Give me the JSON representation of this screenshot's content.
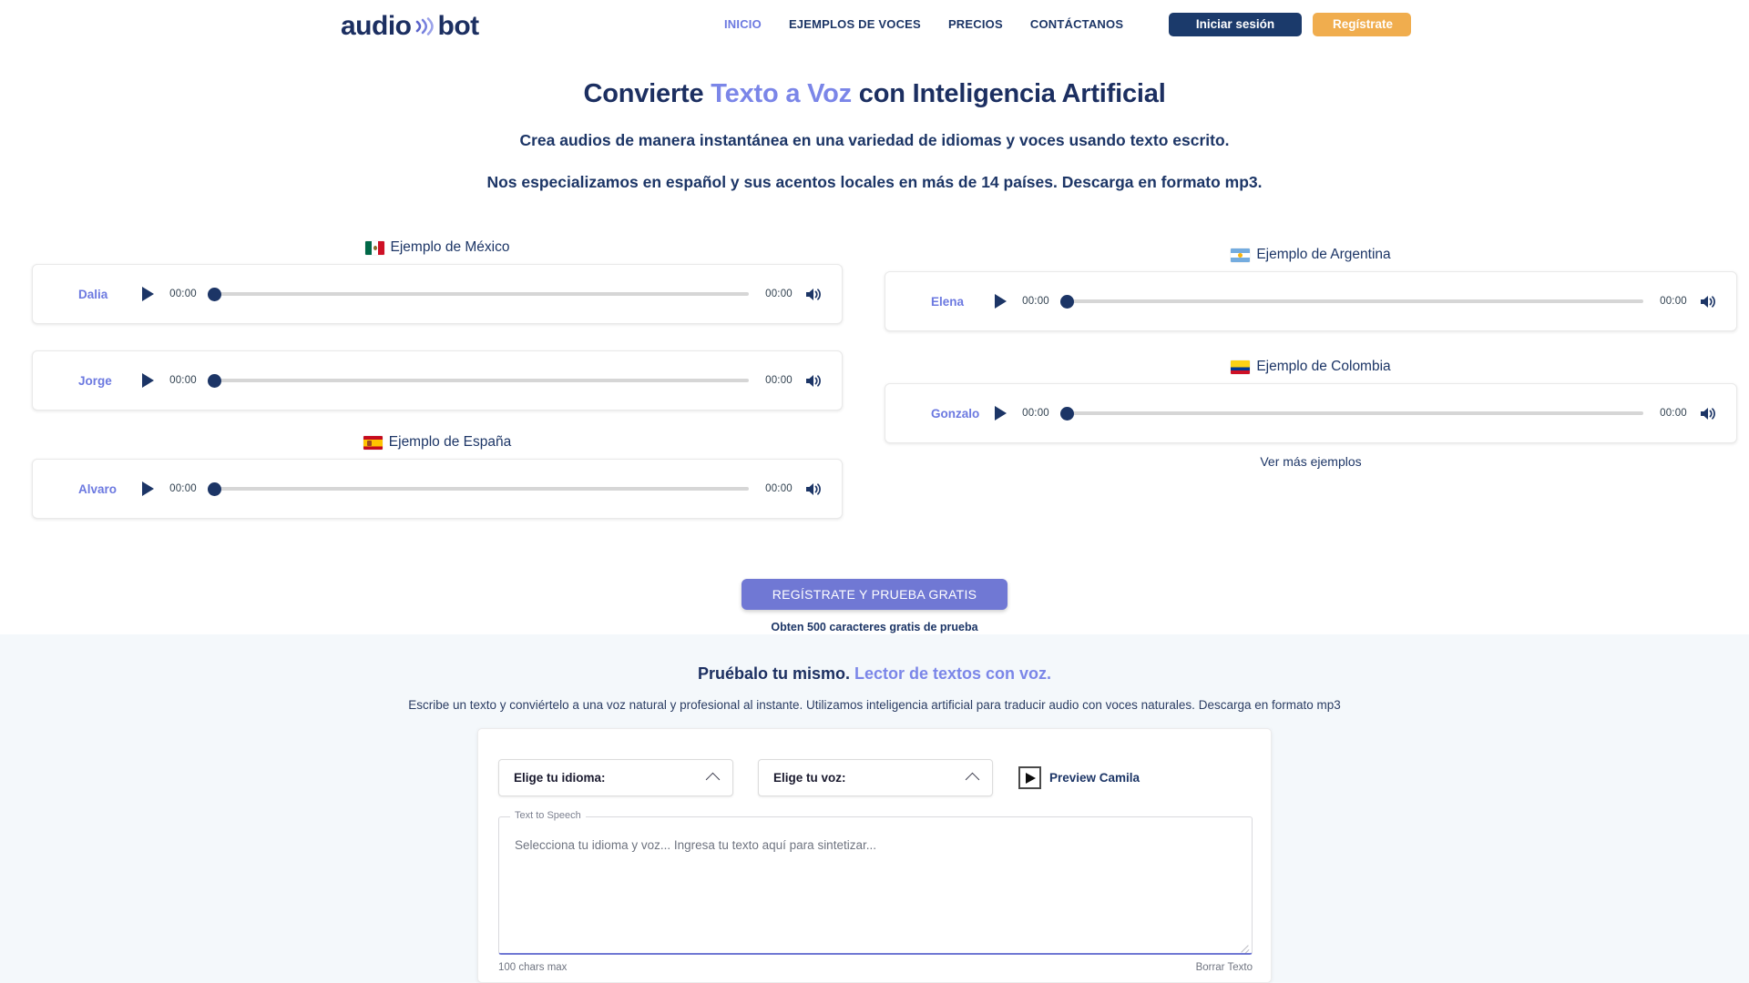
{
  "header": {
    "logo": {
      "part1": "audio",
      "part2": "bot",
      "icon": "sound-wave-icon"
    },
    "nav": [
      {
        "label": "INICIO",
        "active": true
      },
      {
        "label": "EJEMPLOS DE VOCES",
        "active": false
      },
      {
        "label": "PRECIOS",
        "active": false
      },
      {
        "label": "CONTÁCTANOS",
        "active": false
      }
    ],
    "login_label": "Iniciar sesión",
    "signup_label": "Regístrate",
    "colors": {
      "login_bg": "#1b3a6b",
      "signup_bg": "#f0ad4e",
      "nav_active": "#6c79e0",
      "nav": "#1c3566"
    }
  },
  "hero": {
    "title_part1": "Convierte ",
    "title_accent": "Texto a Voz",
    "title_part2": " con Inteligencia Artificial",
    "subtitle1": "Crea audios de manera instantánea en una variedad de idiomas y voces usando texto escrito.",
    "subtitle2": "Nos especializamos en español y sus acentos locales en más de 14 países. Descarga en formato mp3.",
    "accent_color": "#7b86e8",
    "text_color": "#1c2f61"
  },
  "examples": {
    "left": [
      {
        "title": "Ejemplo de México",
        "flag": "mexico-flag-icon",
        "flag_class": "flag-mx",
        "players": [
          {
            "name": "Dalia",
            "current_time": "00:00",
            "total_time": "00:00",
            "progress": 0
          }
        ]
      },
      {
        "title": "",
        "flag": "",
        "flag_class": "",
        "players": [
          {
            "name": "Jorge",
            "current_time": "00:00",
            "total_time": "00:00",
            "progress": 0
          }
        ]
      },
      {
        "title": "Ejemplo de España",
        "flag": "spain-flag-icon",
        "flag_class": "flag-es",
        "players": [
          {
            "name": "Alvaro",
            "current_time": "00:00",
            "total_time": "00:00",
            "progress": 0
          }
        ]
      }
    ],
    "right": [
      {
        "title": "Ejemplo de Argentina",
        "flag": "argentina-flag-icon",
        "flag_class": "flag-ar",
        "players": [
          {
            "name": "Elena",
            "current_time": "00:00",
            "total_time": "00:00",
            "progress": 0
          }
        ]
      },
      {
        "title": "Ejemplo de Colombia",
        "flag": "colombia-flag-icon",
        "flag_class": "flag-co",
        "players": [
          {
            "name": "Gonzalo",
            "current_time": "00:00",
            "total_time": "00:00",
            "progress": 0
          }
        ]
      }
    ],
    "more_link": "Ver más ejemplos"
  },
  "cta": {
    "button_label": "REGÍSTRATE Y PRUEBA GRATIS",
    "note": "Obten 500 caracteres gratis de prueba",
    "button_color": "#7078d4"
  },
  "try_section": {
    "title_part1": "Pruébalo tu mismo. ",
    "title_accent": "Lector de textos con voz.",
    "description": "Escribe un texto y conviértelo a una voz natural y profesional al instante. Utilizamos inteligencia artificial para traducir audio con voces naturales. Descarga en formato mp3",
    "language_select": {
      "label": "Elige tu idioma:",
      "icon": "chevron-up-icon"
    },
    "voice_select": {
      "label": "Elige tu voz:",
      "icon": "chevron-up-icon"
    },
    "preview": {
      "label": "Preview Camila",
      "icon": "play-icon"
    },
    "textarea": {
      "legend": "Text to Speech",
      "placeholder": "Selecciona tu idioma y voz... Ingresa tu texto aquí para sintetizar...",
      "value": ""
    },
    "chars_max": "100 chars max",
    "clear_label": "Borrar Texto"
  }
}
